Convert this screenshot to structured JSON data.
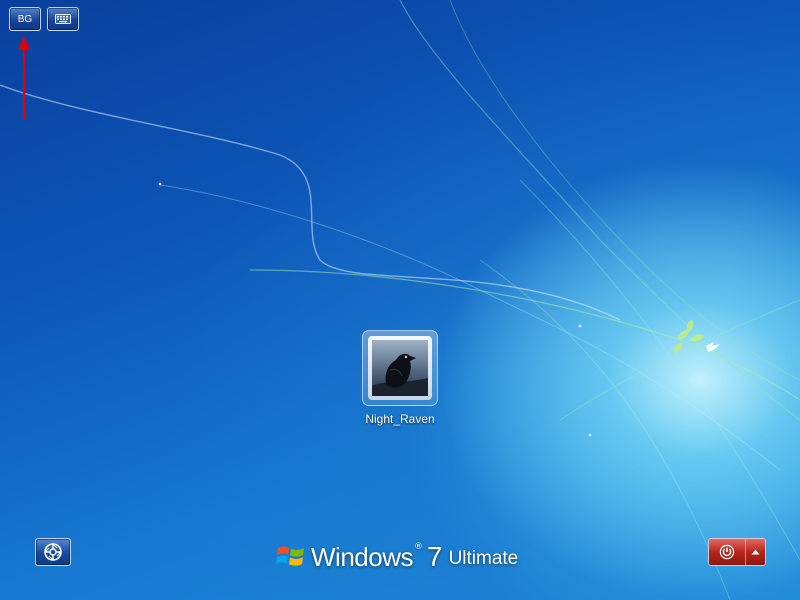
{
  "top_bar": {
    "language_label": "BG",
    "keyboard_icon": "keyboard-icon"
  },
  "user": {
    "name": "Night_Raven",
    "picture_icon": "raven-avatar"
  },
  "branding": {
    "word": "Windows",
    "registered_mark": "®",
    "version": "7",
    "edition": "Ultimate"
  },
  "bottom_controls": {
    "ease_of_access_icon": "ease-of-access-icon",
    "shutdown_icon": "power-icon",
    "shutdown_options_icon": "triangle-up-icon"
  },
  "colors": {
    "annotation_arrow": "#e00000",
    "shutdown_red": "#b5261b",
    "background_blue": "#0d57b8"
  }
}
